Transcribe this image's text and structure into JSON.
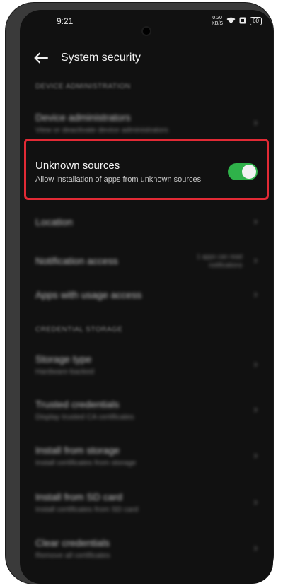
{
  "status_bar": {
    "time": "9:21",
    "net_speed_value": "0.20",
    "net_speed_unit": "KB/S",
    "battery": "60"
  },
  "header": {
    "title": "System security"
  },
  "sections": {
    "device_admin_header": "DEVICE ADMINISTRATION",
    "credentials_header": "CREDENTIAL STORAGE"
  },
  "rows": {
    "device_admins": {
      "label": "Device administrators",
      "sub": "View or deactivate device administrators"
    },
    "unknown_sources": {
      "label": "Unknown sources",
      "sub": "Allow installation of apps from unknown sources",
      "enabled": true
    },
    "location": {
      "label": "Location"
    },
    "notification_access": {
      "label": "Notification access",
      "value_line1": "1 apps can read",
      "value_line2": "notifications"
    },
    "usage_access": {
      "label": "Apps with usage access"
    },
    "storage_type": {
      "label": "Storage type",
      "sub": "Hardware-backed"
    },
    "trusted_credentials": {
      "label": "Trusted credentials",
      "sub": "Display trusted CA certificates"
    },
    "install_storage": {
      "label": "Install from storage",
      "sub": "Install certificates from storage"
    },
    "install_sd": {
      "label": "Install from SD card",
      "sub": "Install certificates from SD card"
    },
    "clear_credentials": {
      "label": "Clear credentials",
      "sub": "Remove all certificates"
    }
  },
  "colors": {
    "toggle_on": "#2fb24a",
    "highlight": "#e22a35",
    "background": "#111111"
  }
}
